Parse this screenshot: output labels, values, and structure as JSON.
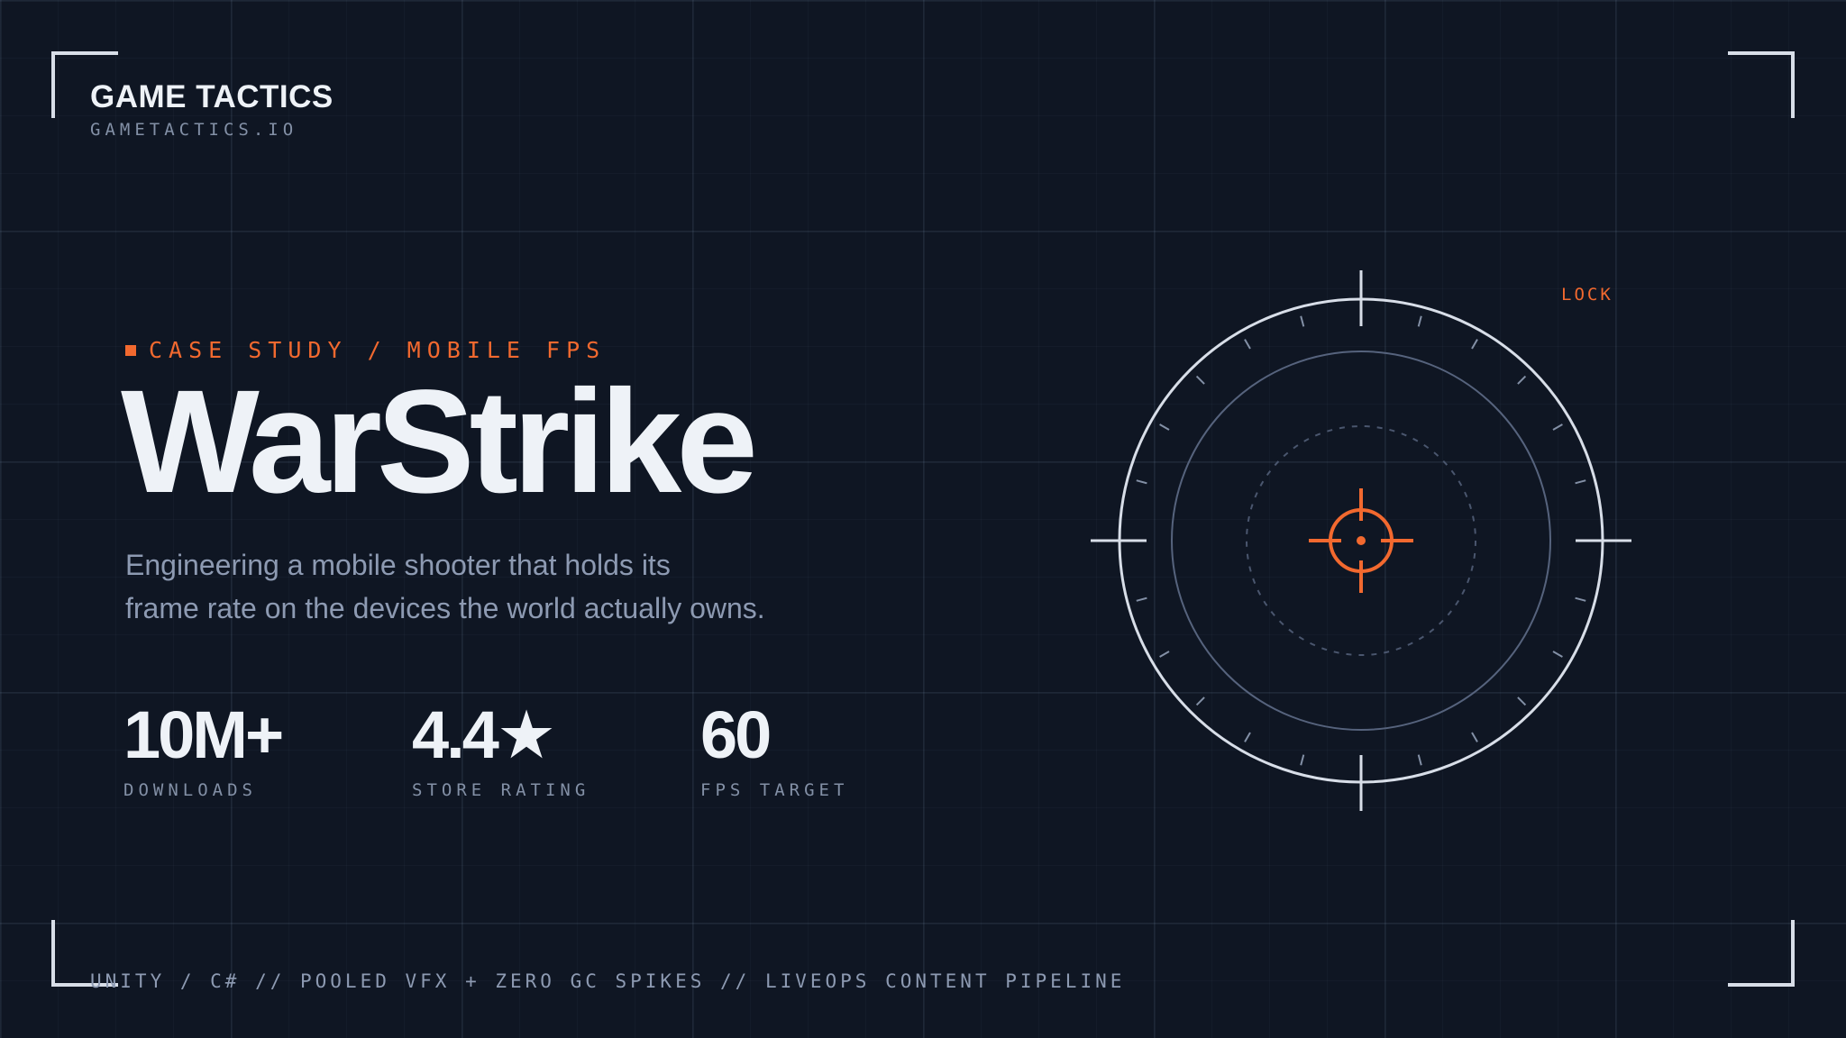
{
  "brand": {
    "name": "GAME TACTICS",
    "url": "GAMETACTICS.IO"
  },
  "hero": {
    "eyebrow": "CASE STUDY / MOBILE FPS",
    "title": "WarStrike",
    "subtitle_lines": [
      "Engineering a mobile shooter that holds its",
      "frame rate on the devices the world actually owns."
    ]
  },
  "stats": [
    {
      "value": "10M+",
      "label": "DOWNLOADS"
    },
    {
      "value": "4.4★",
      "label": "STORE RATING"
    },
    {
      "value": "60",
      "label": "FPS TARGET"
    }
  ],
  "reticle": {
    "lock_label": "LOCK"
  },
  "footer": {
    "tech_line": "UNITY / C# // POOLED VFX + ZERO GC SPIKES // LIVEOPS CONTENT PIPELINE"
  },
  "colors": {
    "background": "#0f1623",
    "accent": "#f2692f",
    "text_primary": "#eef2f7",
    "text_muted": "#8d9ab2"
  },
  "icons": {
    "eyebrow_marker": "square-bullet-icon",
    "reticle_center": "crosshair-icon"
  }
}
